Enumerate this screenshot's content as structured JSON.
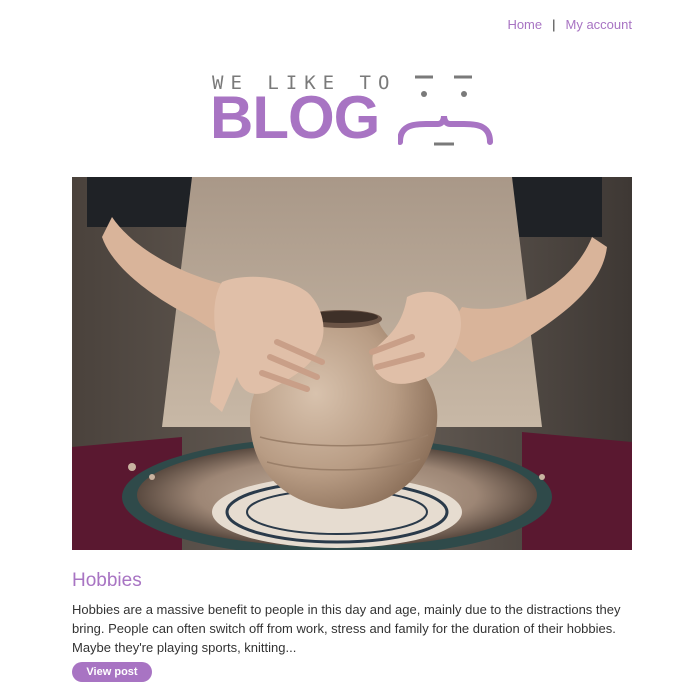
{
  "nav": {
    "home_label": "Home",
    "separator": "|",
    "account_label": "My account"
  },
  "logo": {
    "tagline": "WE LIKE TO",
    "wordmark": "BLOG",
    "colors": {
      "accent": "#a874c3",
      "tagline": "#7a7a7a"
    },
    "face_icon": "winking-face-icon"
  },
  "post": {
    "image_subject": "pottery-wheel-photo",
    "title": "Hobbies",
    "excerpt": "Hobbies are a massive benefit to people in this day and age, mainly due to the distractions they bring. People can often switch off from work, stress and family for the duration of their hobbies. Maybe they're playing sports, knitting...",
    "button_label": "View post"
  },
  "colors": {
    "accent": "#a874c3",
    "body_text": "#333333",
    "background": "#ffffff"
  }
}
